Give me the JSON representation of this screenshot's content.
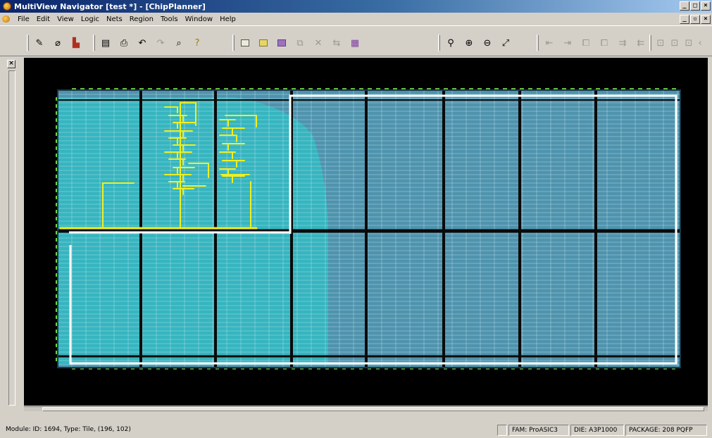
{
  "window": {
    "title": "MultiView Navigator [test *] - [ChipPlanner]",
    "controls": [
      "_",
      "□",
      "×"
    ]
  },
  "menu": {
    "items": [
      {
        "label": "File"
      },
      {
        "label": "Edit"
      },
      {
        "label": "View"
      },
      {
        "label": "Logic"
      },
      {
        "label": "Nets"
      },
      {
        "label": "Region"
      },
      {
        "label": "Tools"
      },
      {
        "label": "Window"
      },
      {
        "label": "Help"
      }
    ],
    "mdi_controls": [
      "_",
      "▫",
      "×"
    ]
  },
  "toolbar": {
    "group1": [
      {
        "icon": "pencil-icon",
        "glyph": "✎"
      },
      {
        "icon": "eraser-icon",
        "glyph": "⌀"
      },
      {
        "icon": "color-palette-icon",
        "glyph": "▙"
      }
    ],
    "group2": [
      {
        "icon": "clipboard-icon",
        "glyph": "▤"
      },
      {
        "icon": "print-icon",
        "glyph": "⎙"
      },
      {
        "icon": "undo-icon",
        "glyph": "↶"
      },
      {
        "icon": "redo-icon",
        "glyph": "↷"
      },
      {
        "icon": "find-icon",
        "glyph": "⌕"
      },
      {
        "icon": "help-pointer-icon",
        "glyph": "?"
      }
    ],
    "group3": [
      {
        "icon": "new-region-icon",
        "glyph": "▭"
      },
      {
        "icon": "region-yellow-icon",
        "glyph": "▭"
      },
      {
        "icon": "region-assign-icon",
        "glyph": "▭"
      },
      {
        "icon": "region-edit-icon",
        "glyph": "⧉"
      },
      {
        "icon": "region-delete-icon",
        "glyph": "✕"
      },
      {
        "icon": "region-move-icon",
        "glyph": "⇆"
      },
      {
        "icon": "region-color-icon",
        "glyph": "▦"
      }
    ],
    "group4": [
      {
        "icon": "zoom-icon",
        "glyph": "⚲"
      },
      {
        "icon": "zoom-in-icon",
        "glyph": "⊕"
      },
      {
        "icon": "zoom-out-icon",
        "glyph": "⊖"
      },
      {
        "icon": "zoom-fit-icon",
        "glyph": "⤢"
      }
    ],
    "group5": [
      {
        "icon": "nav-back-icon",
        "glyph": "⇤"
      },
      {
        "icon": "nav-forward-icon",
        "glyph": "⇥"
      },
      {
        "icon": "select-a-icon",
        "glyph": "⧠"
      },
      {
        "icon": "select-b-icon",
        "glyph": "⧠"
      },
      {
        "icon": "expand-icon",
        "glyph": "⇉"
      },
      {
        "icon": "collapse-icon",
        "glyph": "⇇"
      }
    ],
    "group6": [
      {
        "icon": "view-a-icon",
        "glyph": "⊡"
      },
      {
        "icon": "view-b-icon",
        "glyph": "⊡"
      },
      {
        "icon": "view-c-icon",
        "glyph": "⊡"
      },
      {
        "icon": "more-icon",
        "glyph": "‹"
      }
    ]
  },
  "left_panel": {
    "collapse_label": "×"
  },
  "chip": {
    "colors": {
      "background": "#000000",
      "tile_used": "#35b5bf",
      "tile_free": "#4f93ad",
      "row_line": "#9fd4e0",
      "grid_black": "#0a0a0a",
      "net_yellow": "#f0f01e",
      "region_white": "#ffffff",
      "io_green": "#6fd14a"
    }
  },
  "status": {
    "module": "Module: ID: 1694, Type: Tile, (196, 102)",
    "fam": "FAM: ProASIC3",
    "die": "DIE: A3P1000",
    "package": "PACKAGE: 208 PQFP"
  }
}
